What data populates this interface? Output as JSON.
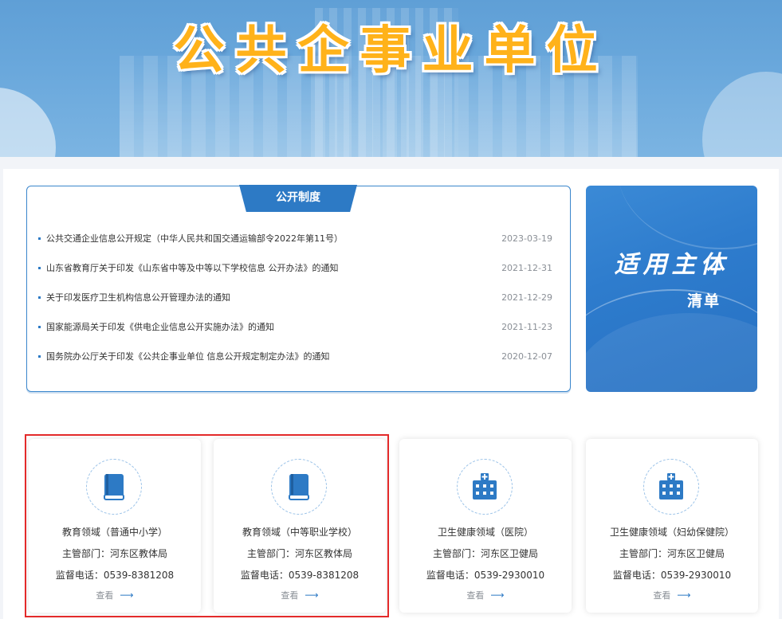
{
  "banner": {
    "title": "公共企事业单位"
  },
  "notice": {
    "tab_label": "公开制度",
    "items": [
      {
        "text": "公共交通企业信息公开规定（中华人民共和国交通运输部令2022年第11号）",
        "date": "2023-03-19"
      },
      {
        "text": "山东省教育厅关于印发《山东省中等及中等以下学校信息 公开办法》的通知",
        "date": "2021-12-31"
      },
      {
        "text": "关于印发医疗卫生机构信息公开管理办法的通知",
        "date": "2021-12-29"
      },
      {
        "text": "国家能源局关于印发《供电企业信息公开实施办法》的通知",
        "date": "2021-11-23"
      },
      {
        "text": "国务院办公厅关于印发《公共企事业单位 信息公开规定制定办法》的通知",
        "date": "2020-12-07"
      }
    ]
  },
  "side_card": {
    "line1": "适用主体",
    "line2": "清单"
  },
  "cards": [
    {
      "name": "教育领域（普通中小学）",
      "dept": "主管部门：河东区教体局",
      "phone": "监督电话：0539-8381208",
      "more": "查看",
      "icon": "book-icon"
    },
    {
      "name": "教育领域（中等职业学校）",
      "dept": "主管部门：河东区教体局",
      "phone": "监督电话：0539-8381208",
      "more": "查看",
      "icon": "book-icon"
    },
    {
      "name": "卫生健康领域（医院）",
      "dept": "主管部门：河东区卫健局",
      "phone": "监督电话：0539-2930010",
      "more": "查看",
      "icon": "hospital-icon"
    },
    {
      "name": "卫生健康领域（妇幼保健院）",
      "dept": "主管部门：河东区卫健局",
      "phone": "监督电话：0539-2930010",
      "more": "查看",
      "icon": "hospital-icon"
    }
  ],
  "colors": {
    "accent": "#2d7ac5",
    "title_orange": "#ffb21a",
    "highlight_red": "#e32a2a"
  }
}
